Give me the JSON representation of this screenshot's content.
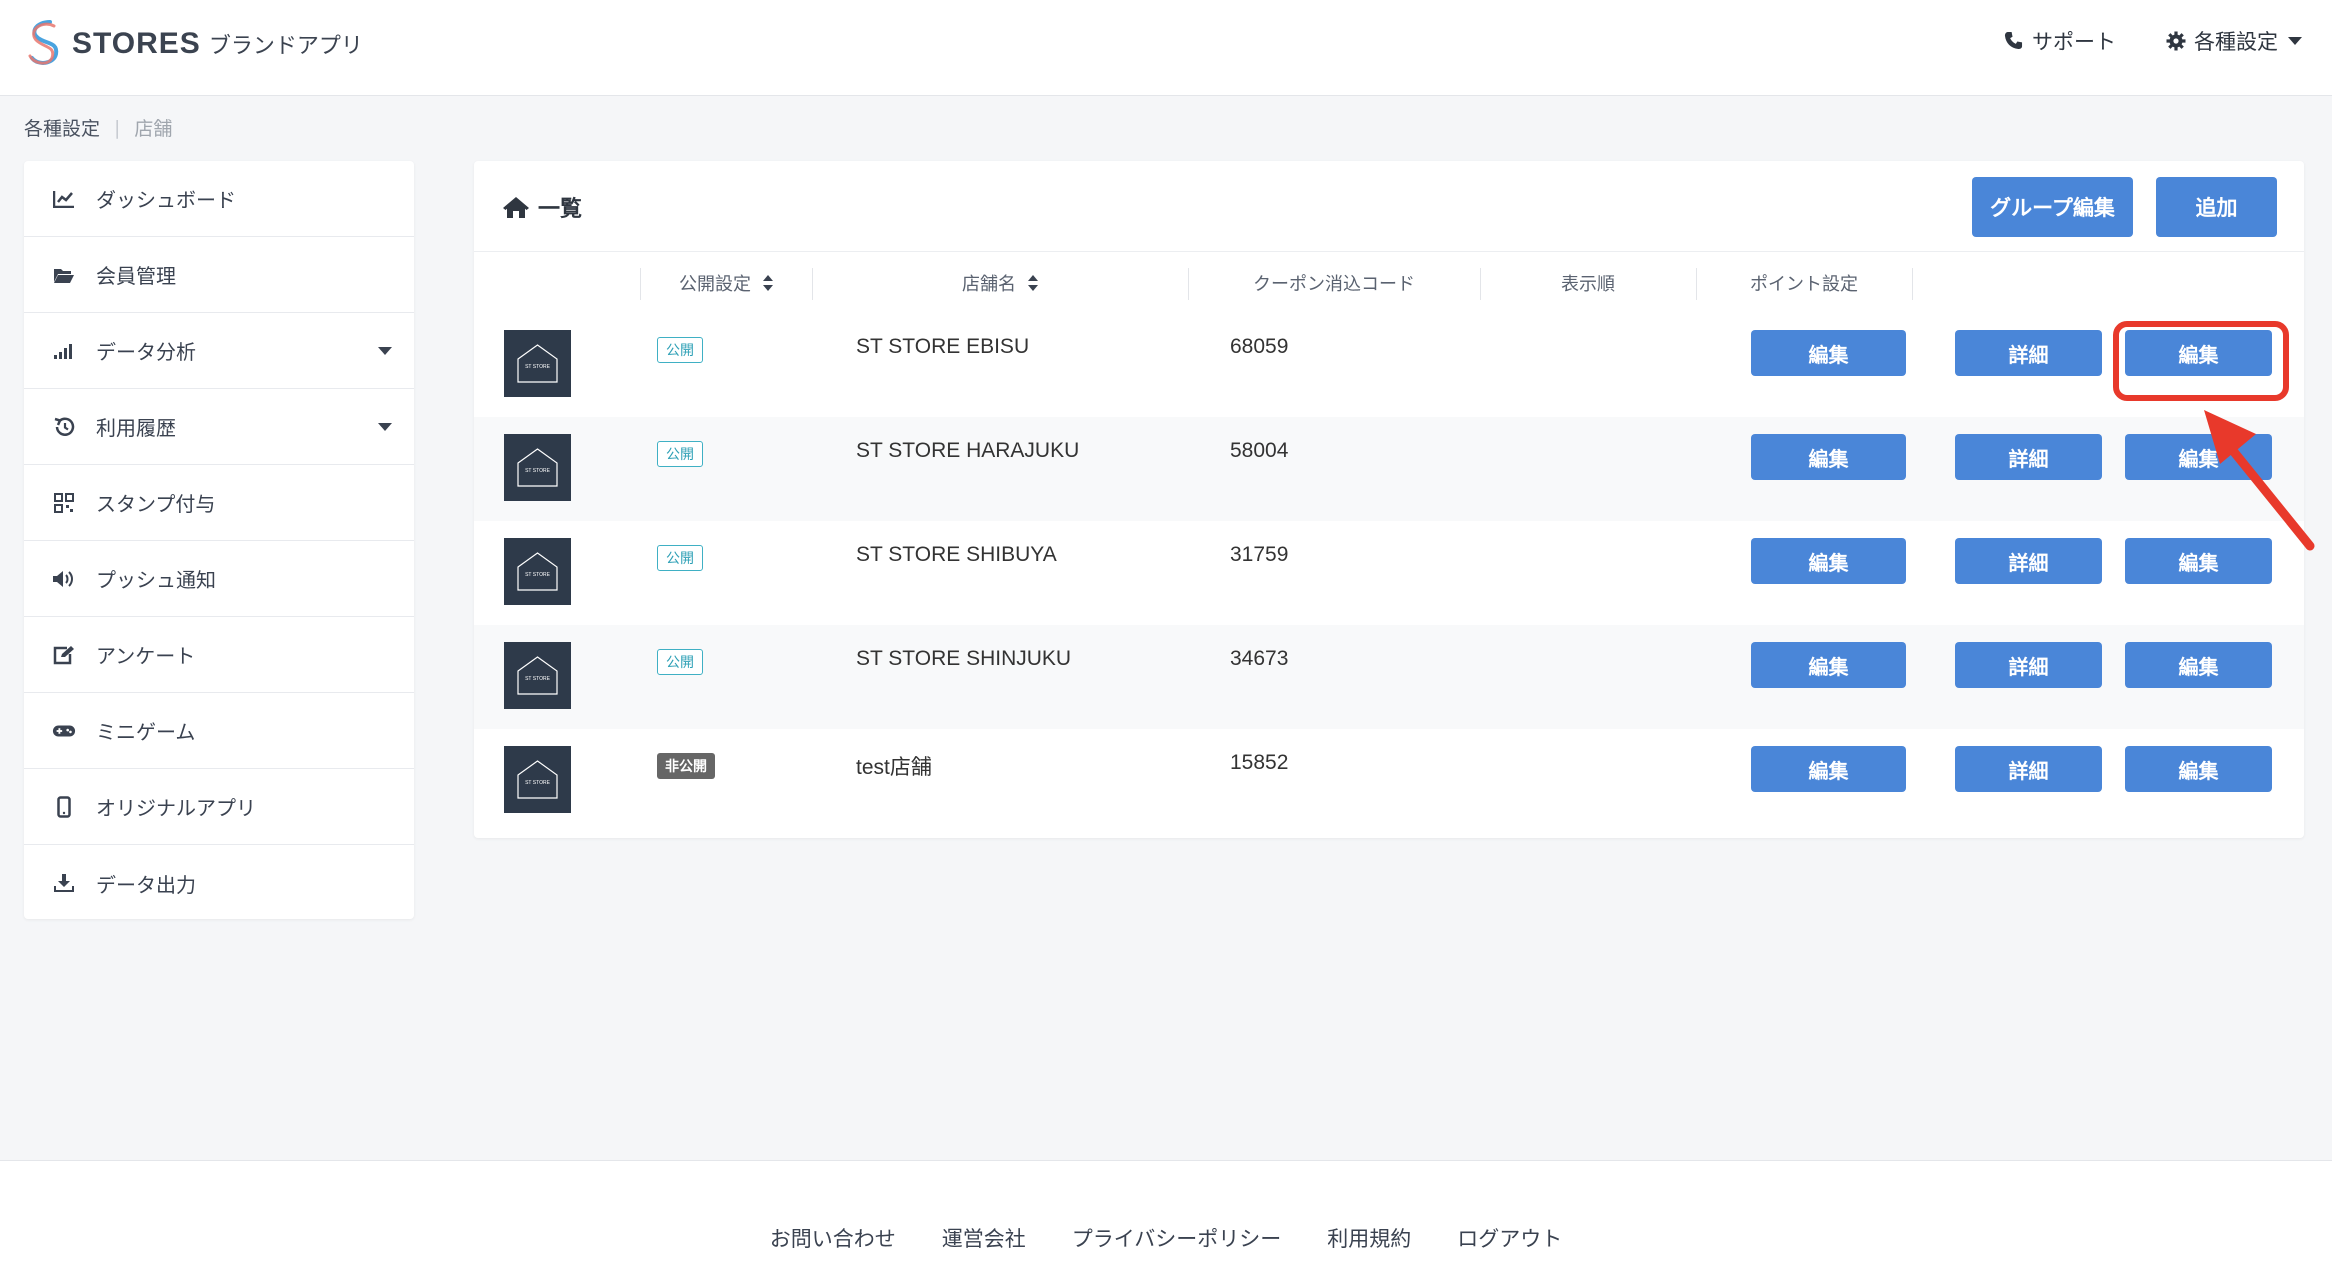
{
  "header": {
    "brand": "STORES",
    "subtitle": "ブランドアプリ",
    "support_label": "サポート",
    "settings_label": "各種設定"
  },
  "breadcrumb": {
    "parent": "各種設定",
    "separator": "|",
    "current": "店舗"
  },
  "sidebar": {
    "items": [
      {
        "label": "ダッシュボード",
        "icon": "chart-line-icon",
        "has_caret": false
      },
      {
        "label": "会員管理",
        "icon": "folder-open-icon",
        "has_caret": false
      },
      {
        "label": "データ分析",
        "icon": "signal-bars-icon",
        "has_caret": true
      },
      {
        "label": "利用履歴",
        "icon": "history-icon",
        "has_caret": true
      },
      {
        "label": "スタンプ付与",
        "icon": "qrcode-icon",
        "has_caret": false
      },
      {
        "label": "プッシュ通知",
        "icon": "volume-icon",
        "has_caret": false
      },
      {
        "label": "アンケート",
        "icon": "edit-icon",
        "has_caret": false
      },
      {
        "label": "ミニゲーム",
        "icon": "gamepad-icon",
        "has_caret": false
      },
      {
        "label": "オリジナルアプリ",
        "icon": "mobile-icon",
        "has_caret": false
      },
      {
        "label": "データ出力",
        "icon": "download-icon",
        "has_caret": false
      }
    ]
  },
  "panel": {
    "title": "一覧",
    "group_edit_label": "グループ編集",
    "add_label": "追加",
    "columns": [
      "公開設定",
      "店舗名",
      "クーポン消込コード",
      "表示順",
      "ポイント設定"
    ],
    "thumb_text": "ST STORE",
    "rows": [
      {
        "status": "公開",
        "public": true,
        "name": "ST STORE EBISU",
        "code": "68059",
        "point_btn": "編集",
        "detail_btn": "詳細",
        "edit_btn": "編集"
      },
      {
        "status": "公開",
        "public": true,
        "name": "ST STORE HARAJUKU",
        "code": "58004",
        "point_btn": "編集",
        "detail_btn": "詳細",
        "edit_btn": "編集"
      },
      {
        "status": "公開",
        "public": true,
        "name": "ST STORE SHIBUYA",
        "code": "31759",
        "point_btn": "編集",
        "detail_btn": "詳細",
        "edit_btn": "編集"
      },
      {
        "status": "公開",
        "public": true,
        "name": "ST STORE SHINJUKU",
        "code": "34673",
        "point_btn": "編集",
        "detail_btn": "詳細",
        "edit_btn": "編集"
      },
      {
        "status": "非公開",
        "public": false,
        "name": "test店舗",
        "code": "15852",
        "point_btn": "編集",
        "detail_btn": "詳細",
        "edit_btn": "編集"
      }
    ]
  },
  "footer": {
    "links": [
      "お問い合わせ",
      "運営会社",
      "プライバシーポリシー",
      "利用規約",
      "ログアウト"
    ]
  },
  "colors": {
    "primary_button": "#4a86d8",
    "highlight": "#e8392b",
    "public_badge": "#3fb0c4",
    "private_badge": "#666666"
  }
}
